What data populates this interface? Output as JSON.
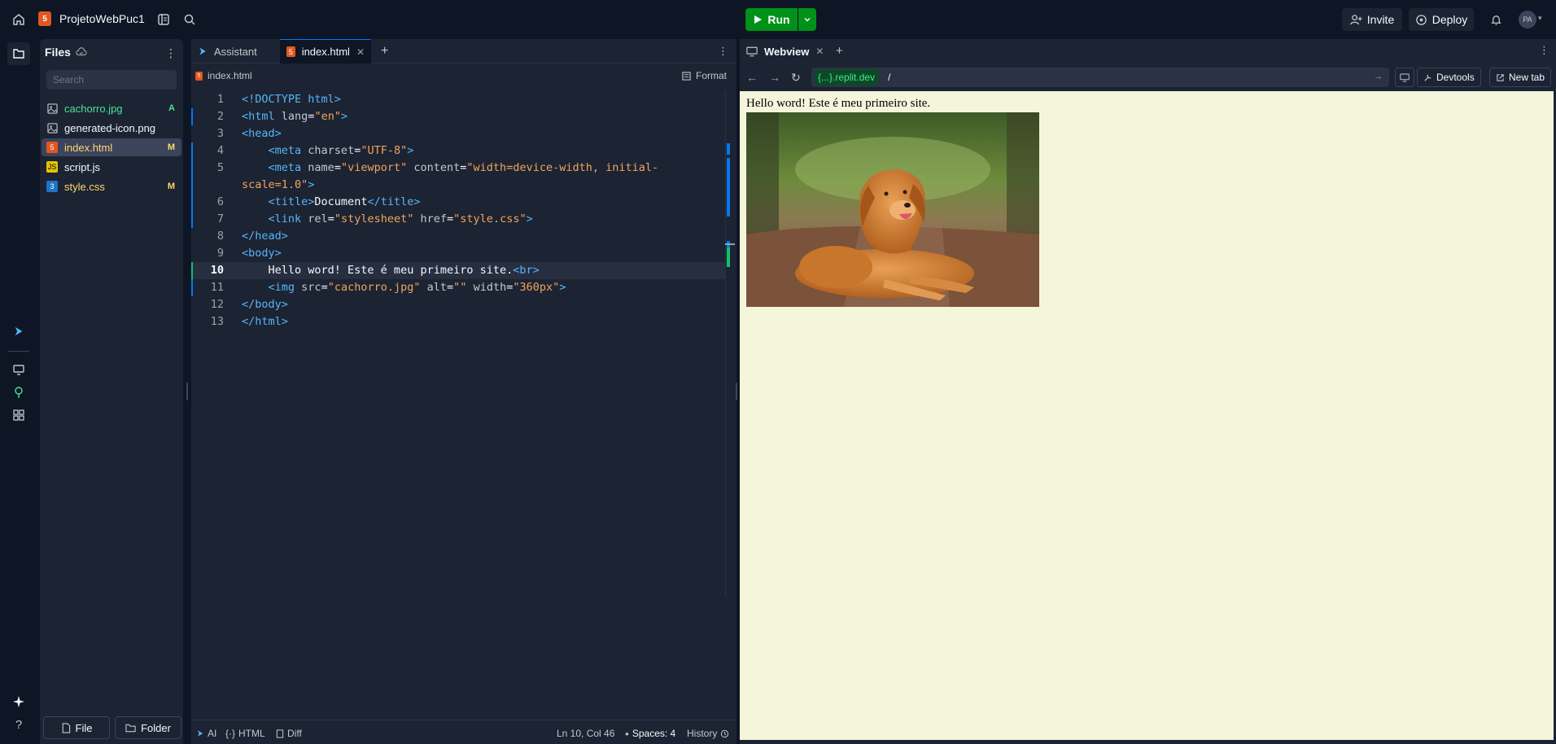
{
  "project": {
    "name": "ProjetoWebPuc1"
  },
  "topbar": {
    "run_label": "Run",
    "invite_label": "Invite",
    "deploy_label": "Deploy",
    "avatar_initials": "PA"
  },
  "files": {
    "title": "Files",
    "search_placeholder": "Search",
    "items": [
      {
        "name": "cachorro.jpg",
        "badge": "A",
        "color": "#46e597",
        "badge_color": "#46e597",
        "icon": "image-icon"
      },
      {
        "name": "generated-icon.png",
        "badge": "",
        "color": "#f5f9fc",
        "badge_color": "",
        "icon": "image-icon"
      },
      {
        "name": "index.html",
        "badge": "M",
        "color": "#ffd76b",
        "badge_color": "#ffd76b",
        "icon": "html-icon"
      },
      {
        "name": "script.js",
        "badge": "",
        "color": "#f5f9fc",
        "badge_color": "",
        "icon": "js-icon"
      },
      {
        "name": "style.css",
        "badge": "M",
        "color": "#ffd76b",
        "badge_color": "#ffd76b",
        "icon": "css-icon"
      }
    ],
    "new_file_label": "File",
    "new_folder_label": "Folder"
  },
  "editor": {
    "tabs": [
      {
        "label": "Assistant"
      },
      {
        "label": "index.html"
      }
    ],
    "breadcrumb": "index.html",
    "format_label": "Format",
    "lines": [
      {
        "n": "1",
        "html": "<span class=\"tag\">&lt;!DOCTYPE html&gt;</span>"
      },
      {
        "n": "2",
        "html": "<span class=\"tag\">&lt;html</span> <span class=\"attr\">lang</span>=<span class=\"str\">\"en\"</span><span class=\"tag\">&gt;</span>"
      },
      {
        "n": "3",
        "html": "<span class=\"tag\">&lt;head&gt;</span>"
      },
      {
        "n": "4",
        "html": "    <span class=\"tag\">&lt;meta</span> <span class=\"attr\">charset</span>=<span class=\"str\">\"UTF-8\"</span><span class=\"tag\">&gt;</span>"
      },
      {
        "n": "5",
        "html": "    <span class=\"tag\">&lt;meta</span> <span class=\"attr\">name</span>=<span class=\"str\">\"viewport\"</span> <span class=\"attr\">content</span>=<span class=\"str\">\"width=device-width, initial-</span>"
      },
      {
        "n": "",
        "html": "<span class=\"str\">scale=1.0\"</span><span class=\"tag\">&gt;</span>"
      },
      {
        "n": "6",
        "html": "    <span class=\"tag\">&lt;title&gt;</span>Document<span class=\"tag\">&lt;/title&gt;</span>"
      },
      {
        "n": "7",
        "html": "    <span class=\"tag\">&lt;link</span> <span class=\"attr\">rel</span>=<span class=\"str\">\"stylesheet\"</span> <span class=\"attr\">href</span>=<span class=\"str\">\"style.css\"</span><span class=\"tag\">&gt;</span>"
      },
      {
        "n": "8",
        "html": "<span class=\"tag\">&lt;/head&gt;</span>"
      },
      {
        "n": "9",
        "html": "<span class=\"tag\">&lt;body&gt;</span>"
      },
      {
        "n": "10",
        "html": "    Hello word! Este é meu primeiro site.<span class=\"tag\">&lt;br&gt;</span>"
      },
      {
        "n": "11",
        "html": "    <span class=\"tag\">&lt;img</span> <span class=\"attr\">src</span>=<span class=\"str\">\"cachorro.jpg\"</span> <span class=\"attr\">alt</span>=<span class=\"str\">\"\"</span> <span class=\"attr\">width</span>=<span class=\"str\">\"360px\"</span><span class=\"tag\">&gt;</span>"
      },
      {
        "n": "12",
        "html": "<span class=\"tag\">&lt;/body&gt;</span>"
      },
      {
        "n": "13",
        "html": "<span class=\"tag\">&lt;/html&gt;</span>"
      }
    ],
    "status": {
      "ai": "AI",
      "lang": "HTML",
      "diff": "Diff",
      "position": "Ln 10, Col 46",
      "spaces": "Spaces: 4",
      "history": "History"
    }
  },
  "webview": {
    "tab_label": "Webview",
    "url_domain": "{...}.replit.dev",
    "url_path": "/",
    "devtools_label": "Devtools",
    "new_tab_label": "New tab",
    "page_text": "Hello word! Este é meu primeiro site."
  }
}
